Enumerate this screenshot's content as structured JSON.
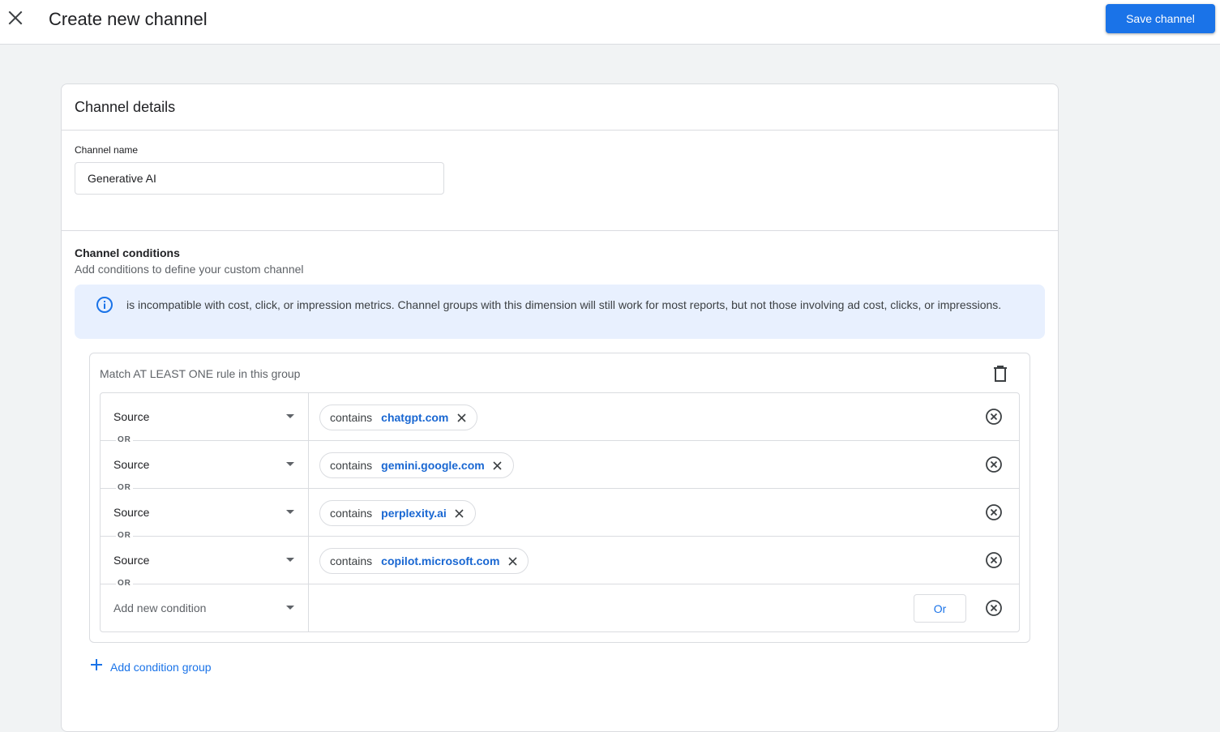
{
  "header": {
    "close_icon": "close-icon",
    "title": "Create new channel",
    "save_label": "Save channel"
  },
  "card": {
    "title": "Channel details"
  },
  "channel_name": {
    "label": "Channel name",
    "value": "Generative AI"
  },
  "conditions": {
    "title": "Channel conditions",
    "subtitle": "Add conditions to define your custom channel",
    "info_text": "is incompatible with cost, click, or impression metrics. Channel groups with this dimension will still work for most reports, but not those involving ad cost, clicks, or impressions."
  },
  "group": {
    "label": "Match AT LEAST ONE rule in this group",
    "rules": [
      {
        "dimension": "Source",
        "operator": "contains",
        "value": "chatgpt.com"
      },
      {
        "dimension": "Source",
        "operator": "contains",
        "value": "gemini.google.com"
      },
      {
        "dimension": "Source",
        "operator": "contains",
        "value": "perplexity.ai"
      },
      {
        "dimension": "Source",
        "operator": "contains",
        "value": "copilot.microsoft.com"
      }
    ],
    "or_separator": "OR",
    "new_condition_placeholder": "Add new condition",
    "or_button_label": "Or"
  },
  "add_group_label": "Add condition group",
  "colors": {
    "accent": "#1a73e8",
    "chip_value": "#1967d2",
    "banner_bg": "#e8f0fe",
    "page_bg": "#f1f3f4"
  }
}
